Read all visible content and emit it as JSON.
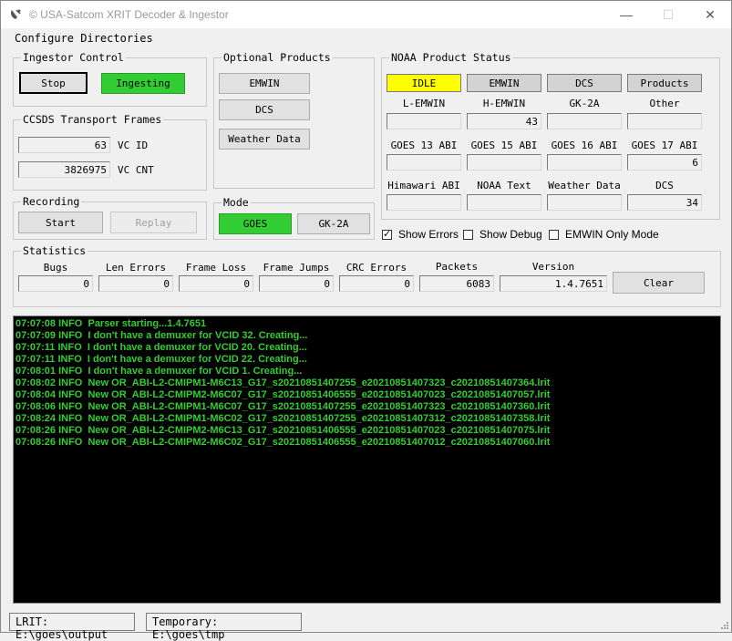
{
  "window": {
    "title": "© USA-Satcom XRIT Decoder & Ingestor",
    "minimize": "—",
    "maximize": "☐",
    "close": "✕"
  },
  "menu": {
    "configure": "Configure Directories"
  },
  "ingestor": {
    "legend": "Ingestor Control",
    "stop": "Stop",
    "state": "Ingesting"
  },
  "ccsds": {
    "legend": "CCSDS Transport Frames",
    "vc_id_value": "63",
    "vc_id_label": "VC ID",
    "vc_cnt_value": "3826975",
    "vc_cnt_label": "VC CNT"
  },
  "recording": {
    "legend": "Recording",
    "start": "Start",
    "replay": "Replay"
  },
  "optional": {
    "legend": "Optional Products",
    "emwin": "EMWIN",
    "dcs": "DCS",
    "weather": "Weather Data"
  },
  "mode": {
    "legend": "Mode",
    "goes": "GOES",
    "gk2a": "GK-2A"
  },
  "noaa": {
    "legend": "NOAA Product Status",
    "top": [
      "IDLE",
      "EMWIN",
      "DCS",
      "Products"
    ],
    "row1_labels": [
      "L-EMWIN",
      "H-EMWIN",
      "GK-2A",
      "Other"
    ],
    "row1_values": [
      "",
      "43",
      "",
      ""
    ],
    "row2_labels": [
      "GOES 13 ABI",
      "GOES 15 ABI",
      "GOES 16 ABI",
      "GOES 17 ABI"
    ],
    "row2_values": [
      "",
      "",
      "",
      "6"
    ],
    "row3_labels": [
      "Himawari ABI",
      "NOAA Text",
      "Weather Data",
      "DCS"
    ],
    "row3_values": [
      "",
      "",
      "",
      "34"
    ],
    "idle_color": "#ffff00"
  },
  "checks": {
    "show_errors": "Show Errors",
    "show_errors_checked": true,
    "show_debug": "Show Debug",
    "emwin_only": "EMWIN Only Mode"
  },
  "stats": {
    "legend": "Statistics",
    "labels": [
      "Bugs",
      "Len Errors",
      "Frame Loss",
      "Frame Jumps",
      "CRC Errors",
      "Packets",
      "Version"
    ],
    "values": [
      "0",
      "0",
      "0",
      "0",
      "0",
      "6083",
      "1.4.7651"
    ],
    "clear": "Clear"
  },
  "log": [
    "07:07:08 INFO  Parser starting...1.4.7651",
    "07:07:09 INFO  I don't have a demuxer for VCID 32. Creating...",
    "07:07:11 INFO  I don't have a demuxer for VCID 20. Creating...",
    "07:07:11 INFO  I don't have a demuxer for VCID 22. Creating...",
    "07:08:01 INFO  I don't have a demuxer for VCID 1. Creating...",
    "07:08:02 INFO  New OR_ABI-L2-CMIPM1-M6C13_G17_s20210851407255_e20210851407323_c20210851407364.lrit",
    "07:08:04 INFO  New OR_ABI-L2-CMIPM2-M6C07_G17_s20210851406555_e20210851407023_c20210851407057.lrit",
    "07:08:06 INFO  New OR_ABI-L2-CMIPM1-M6C07_G17_s20210851407255_e20210851407323_c20210851407360.lrit",
    "07:08:24 INFO  New OR_ABI-L2-CMIPM1-M6C02_G17_s20210851407255_e20210851407312_c20210851407358.lrit",
    "07:08:26 INFO  New OR_ABI-L2-CMIPM2-M6C13_G17_s20210851406555_e20210851407023_c20210851407075.lrit",
    "07:08:26 INFO  New OR_ABI-L2-CMIPM2-M6C02_G17_s20210851406555_e20210851407012_c20210851407060.lrit"
  ],
  "statusbar": {
    "lrit": "LRIT: E:\\goes\\output",
    "temp": "Temporary: E:\\goes\\tmp"
  },
  "colors": {
    "green": "#32cd32",
    "log_bg": "#000000",
    "log_text": "#32cd32"
  }
}
